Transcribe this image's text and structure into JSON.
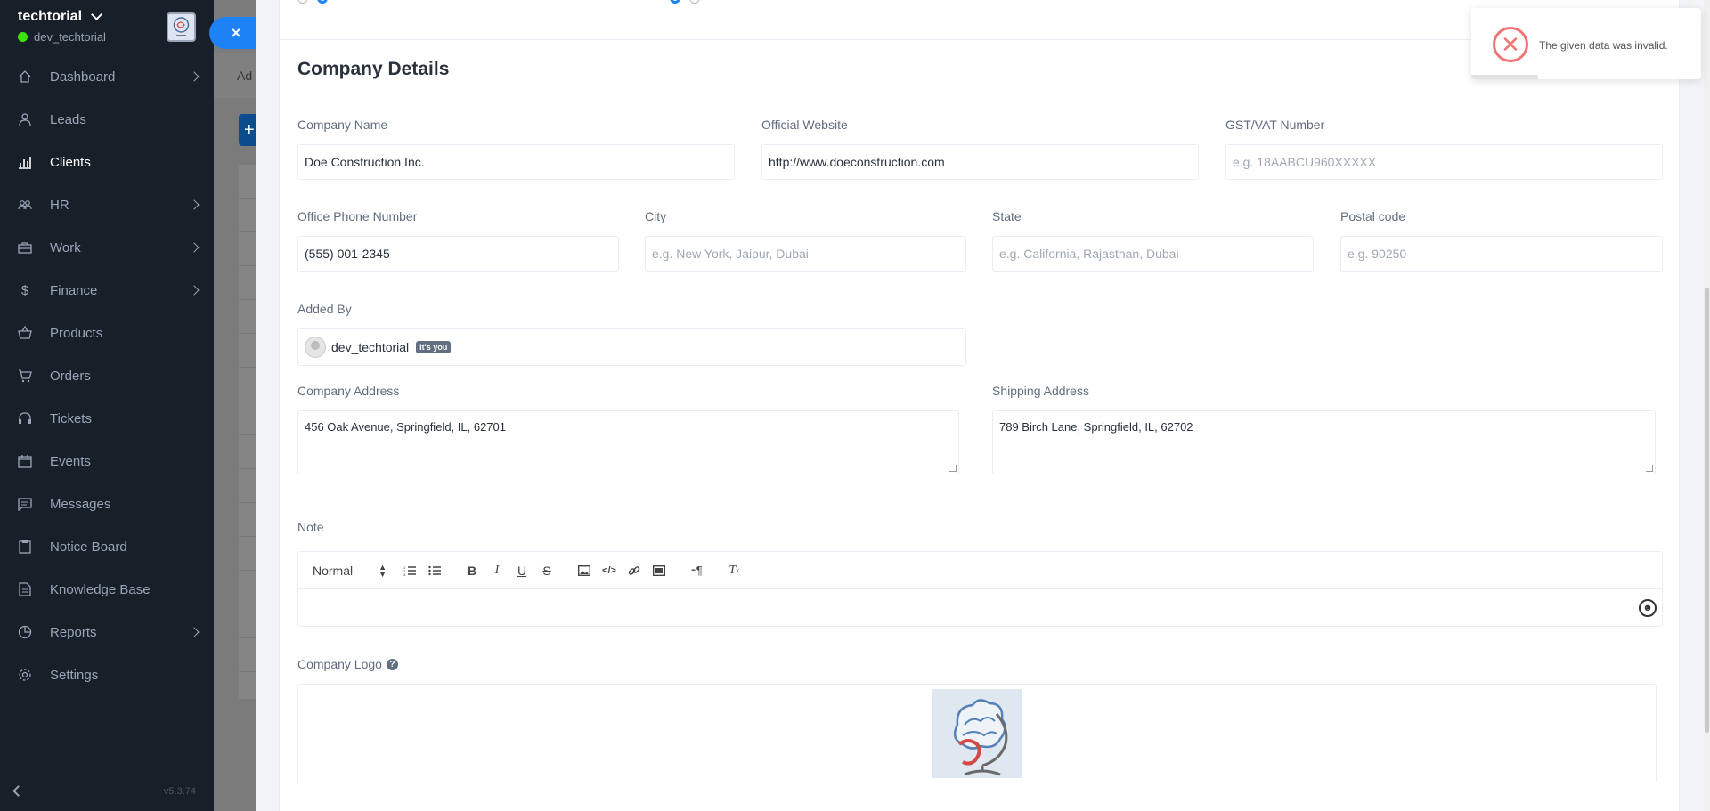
{
  "sidebar": {
    "company": "techtorial",
    "user": "dev_techtorial",
    "version": "v5.3.74",
    "items": [
      {
        "label": "Dashboard",
        "icon": "house-icon",
        "arrow": true
      },
      {
        "label": "Leads",
        "icon": "person-icon",
        "arrow": false
      },
      {
        "label": "Clients",
        "icon": "bar-chart-icon",
        "arrow": false,
        "active": true
      },
      {
        "label": "HR",
        "icon": "people-icon",
        "arrow": true
      },
      {
        "label": "Work",
        "icon": "briefcase-icon",
        "arrow": true
      },
      {
        "label": "Finance",
        "icon": "dollar-icon",
        "arrow": true
      },
      {
        "label": "Products",
        "icon": "basket-icon",
        "arrow": false
      },
      {
        "label": "Orders",
        "icon": "cart-icon",
        "arrow": false
      },
      {
        "label": "Tickets",
        "icon": "headset-icon",
        "arrow": false
      },
      {
        "label": "Events",
        "icon": "calendar-icon",
        "arrow": false
      },
      {
        "label": "Messages",
        "icon": "chat-icon",
        "arrow": false
      },
      {
        "label": "Notice Board",
        "icon": "clipboard-icon",
        "arrow": false
      },
      {
        "label": "Knowledge Base",
        "icon": "document-icon",
        "arrow": false
      },
      {
        "label": "Reports",
        "icon": "pie-chart-icon",
        "arrow": true
      },
      {
        "label": "Settings",
        "icon": "gear-icon",
        "arrow": false
      }
    ]
  },
  "background": {
    "tab_label": "Ad",
    "add_label": "+"
  },
  "close_label": "×",
  "form": {
    "section_title": "Company Details",
    "company_name": {
      "label": "Company Name",
      "value": "Doe Construction Inc."
    },
    "website": {
      "label": "Official Website",
      "value": "http://www.doeconstruction.com"
    },
    "gst": {
      "label": "GST/VAT Number",
      "placeholder": "e.g. 18AABCU960XXXXX"
    },
    "phone": {
      "label": "Office Phone Number",
      "value": "(555) 001-2345"
    },
    "city": {
      "label": "City",
      "placeholder": "e.g. New York, Jaipur, Dubai"
    },
    "state": {
      "label": "State",
      "placeholder": "e.g. California, Rajasthan, Dubai"
    },
    "postal": {
      "label": "Postal code",
      "placeholder": "e.g. 90250"
    },
    "added_by": {
      "label": "Added By",
      "value": "dev_techtorial",
      "badge": "It's you"
    },
    "company_address": {
      "label": "Company Address",
      "value": "456 Oak Avenue, Springfield, IL, 62701"
    },
    "shipping_address": {
      "label": "Shipping Address",
      "value": "789 Birch Lane, Springfield, IL, 62702"
    },
    "note": {
      "label": "Note",
      "format_select": "Normal"
    },
    "logo": {
      "label": "Company Logo"
    }
  },
  "toast": {
    "message": "The given data was invalid.",
    "progress": 0.29,
    "status_color": "#f27474"
  },
  "colors": {
    "sidebar_bg": "#171f29",
    "accent": "#1d82f5"
  }
}
